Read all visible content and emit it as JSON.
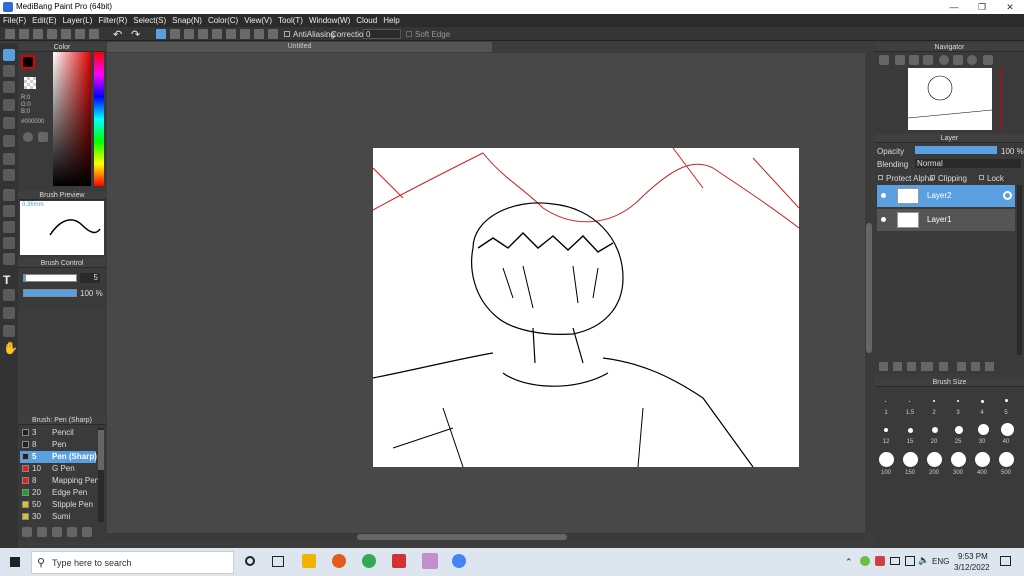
{
  "window": {
    "title": "MediBang Paint Pro (64bit)"
  },
  "menu": [
    "File(F)",
    "Edit(E)",
    "Layer(L)",
    "Filter(R)",
    "Select(S)",
    "Snap(N)",
    "Color(C)",
    "View(V)",
    "Tool(T)",
    "Window(W)",
    "Cloud",
    "Help"
  ],
  "toolbar": {
    "antialias_label": "AntiAliasing",
    "correction_label": "Correction",
    "correction_value": "0",
    "soft_edge_label": "Soft Edge"
  },
  "color_panel": {
    "title": "Color",
    "r": "R:0",
    "g": "G:0",
    "b": "B:0",
    "hex": "#000000",
    "accent": "#e00000"
  },
  "brush_preview": {
    "title": "Brush Preview",
    "size": "0.36mm"
  },
  "brush_control": {
    "title": "Brush Control",
    "size": "5",
    "opacity": "100 %"
  },
  "brush_list": {
    "title": "Brush: Pen (Sharp)",
    "items": [
      {
        "n": "3",
        "label": "Pencil",
        "color": "#222222"
      },
      {
        "n": "8",
        "label": "Pen",
        "color": "#222222"
      },
      {
        "n": "5",
        "label": "Pen (Sharp)",
        "color": "#222222"
      },
      {
        "n": "10",
        "label": "G Pen",
        "color": "#e02020"
      },
      {
        "n": "8",
        "label": "Mapping Pen",
        "color": "#e02020"
      },
      {
        "n": "20",
        "label": "Edge Pen",
        "color": "#20a020"
      },
      {
        "n": "50",
        "label": "Stipple Pen",
        "color": "#e0c020"
      },
      {
        "n": "30",
        "label": "Sumi",
        "color": "#e0c020"
      }
    ]
  },
  "document": {
    "tab": "Untitled"
  },
  "navigator": {
    "title": "Navigator"
  },
  "layer_panel": {
    "title": "Layer",
    "opacity_label": "Opacity",
    "opacity_value": "100 %",
    "blending_label": "Blending",
    "blending_value": "Normal",
    "protect_alpha": "Protect Alpha",
    "clipping": "Clipping",
    "lock": "Lock",
    "layers": [
      "Layer2",
      "Layer1"
    ]
  },
  "brush_size": {
    "title": "Brush Size",
    "sizes": [
      "1",
      "1.5",
      "2",
      "3",
      "4",
      "5",
      "12",
      "15",
      "20",
      "25",
      "30",
      "40",
      "100",
      "150",
      "200",
      "300",
      "400",
      "500"
    ]
  },
  "taskbar": {
    "search_placeholder": "Type here to search",
    "time": "9:53 PM",
    "date": "3/12/2022",
    "lang": "ENG"
  }
}
